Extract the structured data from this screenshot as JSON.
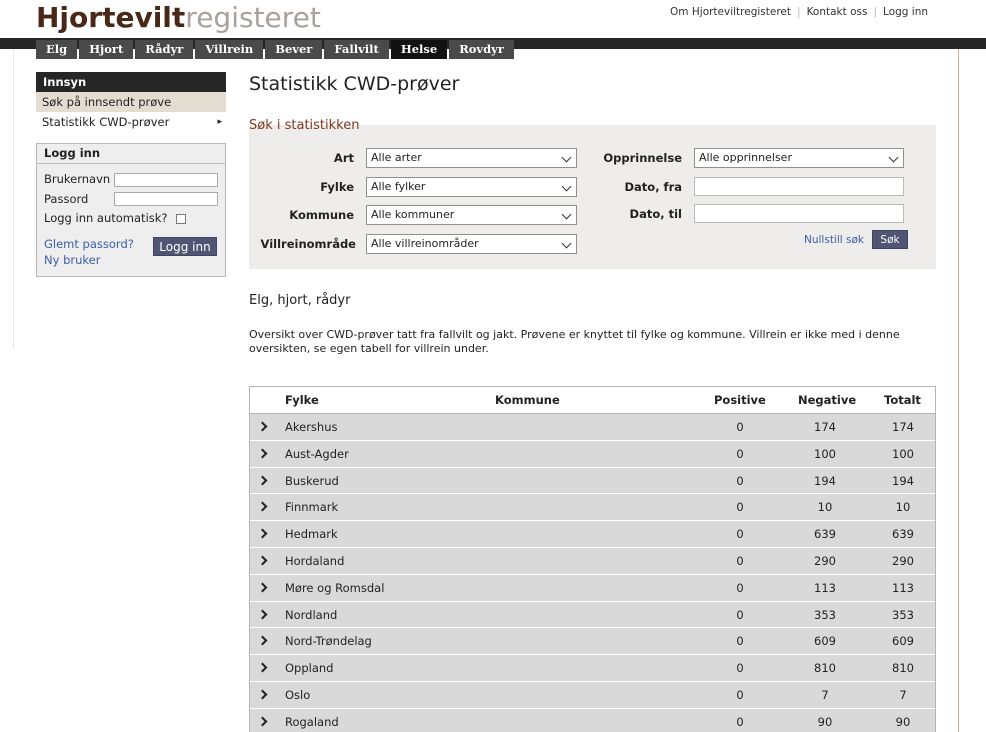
{
  "header": {
    "logo_part1": "Hjortevilt",
    "logo_part2": "registeret",
    "links": [
      "Om Hjorteviltregisteret",
      "Kontakt oss",
      "Logg inn"
    ]
  },
  "nav": {
    "tabs": [
      "Elg",
      "Hjort",
      "Rådyr",
      "Villrein",
      "Bever",
      "Fallvilt",
      "Helse",
      "Rovdyr"
    ],
    "active": "Helse"
  },
  "sidebar": {
    "heading": "Innsyn",
    "items": [
      "Søk på innsendt prøve",
      "Statistikk CWD-prøver"
    ]
  },
  "login": {
    "heading": "Logg inn",
    "username_label": "Brukernavn",
    "password_label": "Passord",
    "auto_label": "Logg inn automatisk?",
    "forgot_link": "Glemt passord?",
    "new_user_link": "Ny bruker",
    "submit_label": "Logg inn"
  },
  "page": {
    "title": "Statistikk CWD-prøver",
    "search_legend": "Søk i statistikken"
  },
  "search": {
    "art_label": "Art",
    "art_value": "Alle arter",
    "fylke_label": "Fylke",
    "fylke_value": "Alle fylker",
    "kommune_label": "Kommune",
    "kommune_value": "Alle kommuner",
    "villrein_label": "Villreinområde",
    "villrein_value": "Alle villreinområder",
    "opprinnelse_label": "Opprinnelse",
    "opprinnelse_value": "Alle opprinnelser",
    "dato_fra_label": "Dato, fra",
    "dato_til_label": "Dato, til",
    "reset_label": "Nullstill søk",
    "submit_label": "Søk"
  },
  "section": {
    "title": "Elg, hjort, rådyr",
    "description": "Oversikt over CWD-prøver tatt fra fallvilt og jakt. Prøvene er knyttet til fylke og kommune. Villrein er ikke med i denne oversikten, se egen tabell for villrein under."
  },
  "table": {
    "columns": [
      "Fylke",
      "Kommune",
      "Positive",
      "Negative",
      "Totalt"
    ],
    "rows": [
      {
        "fylke": "Akershus",
        "positive": "0",
        "negative": "174",
        "total": "174"
      },
      {
        "fylke": "Aust-Agder",
        "positive": "0",
        "negative": "100",
        "total": "100"
      },
      {
        "fylke": "Buskerud",
        "positive": "0",
        "negative": "194",
        "total": "194"
      },
      {
        "fylke": "Finnmark",
        "positive": "0",
        "negative": "10",
        "total": "10"
      },
      {
        "fylke": "Hedmark",
        "positive": "0",
        "negative": "639",
        "total": "639"
      },
      {
        "fylke": "Hordaland",
        "positive": "0",
        "negative": "290",
        "total": "290"
      },
      {
        "fylke": "Møre og Romsdal",
        "positive": "0",
        "negative": "113",
        "total": "113"
      },
      {
        "fylke": "Nordland",
        "positive": "0",
        "negative": "353",
        "total": "353"
      },
      {
        "fylke": "Nord-Trøndelag",
        "positive": "0",
        "negative": "609",
        "total": "609"
      },
      {
        "fylke": "Oppland",
        "positive": "0",
        "negative": "810",
        "total": "810"
      },
      {
        "fylke": "Oslo",
        "positive": "0",
        "negative": "7",
        "total": "7"
      },
      {
        "fylke": "Rogaland",
        "positive": "0",
        "negative": "90",
        "total": "90"
      }
    ]
  }
}
